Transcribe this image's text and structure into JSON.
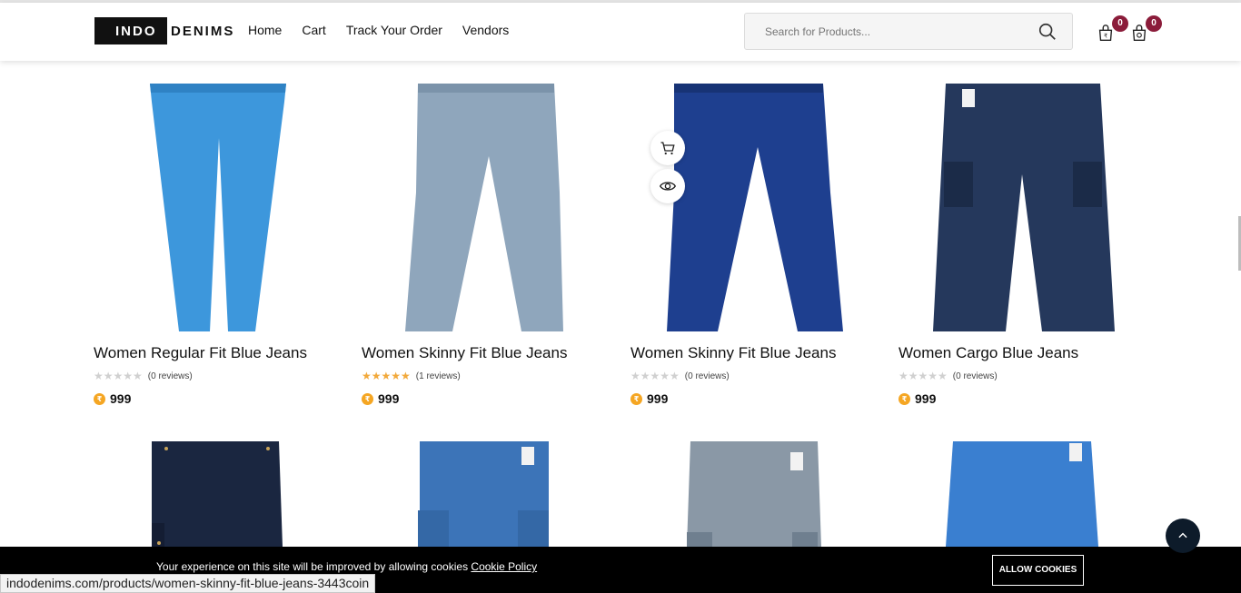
{
  "header": {
    "logo_box": "INDO",
    "logo_rest": "DENIMS",
    "nav": [
      "Home",
      "Cart",
      "Track Your Order",
      "Vendors"
    ],
    "search_placeholder": "Search for Products...",
    "wishlist_count": "0",
    "cart_count": "0"
  },
  "products": [
    {
      "name": "Women Regular Fit Blue Jeans",
      "reviews": "(0 reviews)",
      "rating": 0,
      "price": "999",
      "color": "#3d97dc"
    },
    {
      "name": "Women Skinny Fit Blue Jeans",
      "reviews": "(1 reviews)",
      "rating": 5,
      "price": "999",
      "color": "#8fa6bc"
    },
    {
      "name": "Women Skinny Fit Blue Jeans",
      "reviews": "(0 reviews)",
      "rating": 0,
      "price": "999",
      "color": "#1e3f8f"
    },
    {
      "name": "Women Cargo Blue Jeans",
      "reviews": "(0 reviews)",
      "rating": 0,
      "price": "999",
      "color": "#25385c"
    }
  ],
  "row2_colors": [
    "#1a2640",
    "#3c74b8",
    "#8a98a6",
    "#3a7fd0"
  ],
  "cookie": {
    "text": "Your experience on this site will be improved by allowing cookies",
    "link": "Cookie Policy",
    "button": "ALLOW COOKIES"
  },
  "status_url": "indodenims.com/products/women-skinny-fit-blue-jeans-3443coin"
}
